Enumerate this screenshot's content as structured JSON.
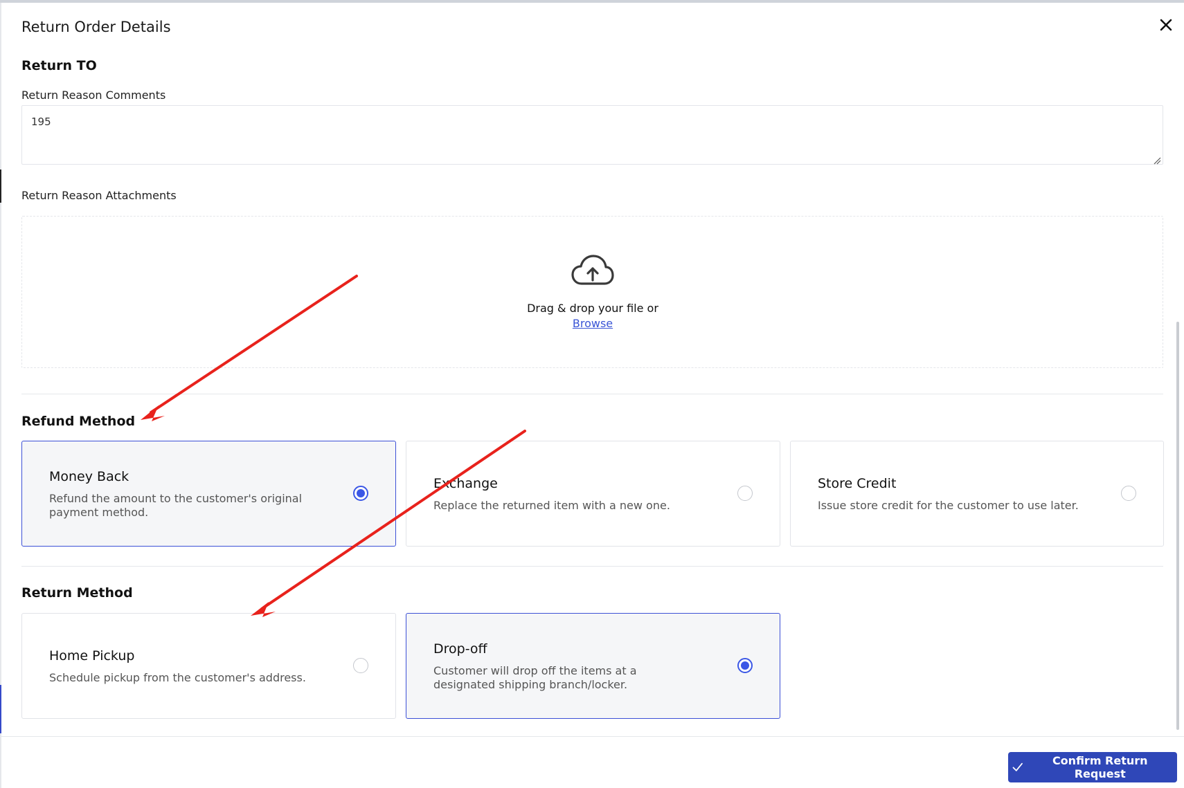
{
  "modal": {
    "title": "Return Order Details"
  },
  "return_to": {
    "heading": "Return TO",
    "comments_label": "Return Reason Comments",
    "comments_value": "195",
    "attachments_label": "Return Reason Attachments",
    "dropzone_text": "Drag & drop your file or",
    "browse_label": "Browse"
  },
  "refund_method": {
    "heading": "Refund Method",
    "options": [
      {
        "title": "Money Back",
        "description": "Refund the amount to the customer's original payment method.",
        "selected": true
      },
      {
        "title": "Exchange",
        "description": "Replace the returned item with a new one.",
        "selected": false
      },
      {
        "title": "Store Credit",
        "description": "Issue store credit for the customer to use later.",
        "selected": false
      }
    ]
  },
  "return_method": {
    "heading": "Return Method",
    "options": [
      {
        "title": "Home Pickup",
        "description": "Schedule pickup from the customer's address.",
        "selected": false
      },
      {
        "title": "Drop-off",
        "description": "Customer will drop off the items at a designated shipping branch/locker.",
        "selected": true
      }
    ]
  },
  "footer": {
    "confirm_label": "Confirm Return Request"
  },
  "colors": {
    "accent": "#3b57e6",
    "button": "#2f47b8",
    "annotation_arrow": "#e8221c"
  },
  "icons": [
    "close-icon",
    "upload-cloud-icon",
    "check-icon"
  ]
}
